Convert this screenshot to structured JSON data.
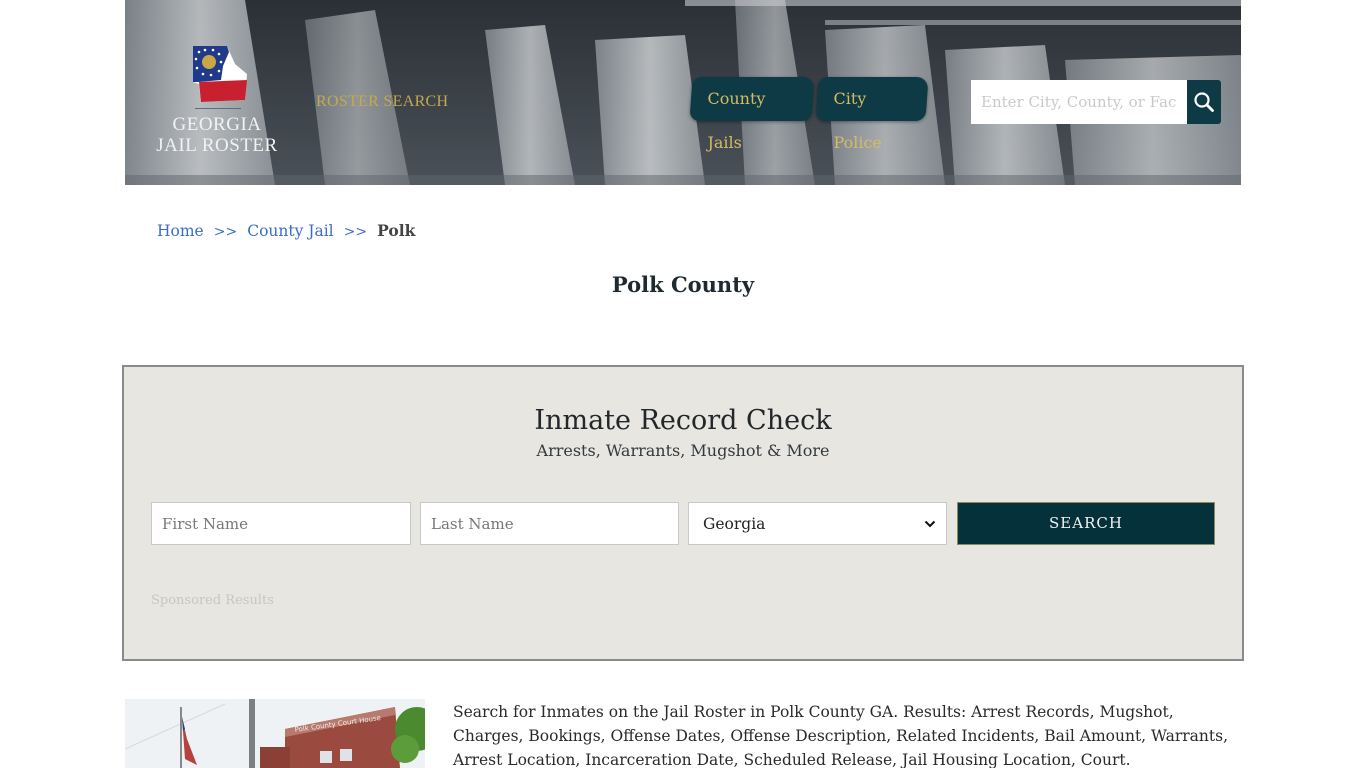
{
  "header": {
    "logo": {
      "line1": "GEORGIA",
      "line2": "JAIL ROSTER",
      "icon": "georgia-flag-map-icon"
    },
    "roster_search_label": "ROSTER SEARCH",
    "nav": [
      {
        "label": "County Jails"
      },
      {
        "label": "City Police"
      }
    ],
    "search": {
      "placeholder": "Enter City, County, or Facility",
      "value": "",
      "icon": "search-icon"
    },
    "colors": {
      "nav_bg": "#0d3a44",
      "nav_text": "#d5bb62",
      "roster_text": "#c5a94d"
    }
  },
  "breadcrumb": {
    "items": [
      {
        "label": "Home"
      },
      {
        "label": "County Jail"
      },
      {
        "label": "Polk"
      }
    ],
    "separator": ">>"
  },
  "page_title": "Polk County",
  "record_check": {
    "title": "Inmate Record Check",
    "subtitle": "Arrests, Warrants, Mugshot & More",
    "first_name": {
      "placeholder": "First Name",
      "value": ""
    },
    "last_name": {
      "placeholder": "Last Name",
      "value": ""
    },
    "state": {
      "selected": "Georgia"
    },
    "submit_label": "SEARCH",
    "sponsored_label": "Sponsored Results",
    "colors": {
      "box_bg": "#e8e6e1",
      "button_bg": "#05313b"
    }
  },
  "content": {
    "image_caption": "Polk County Court House",
    "description": "Search for Inmates on the Jail Roster in Polk County GA. Results: Arrest Records, Mugshot, Charges, Bookings, Offense Dates, Offense Description, Related Incidents, Bail Amount, Warrants, Arrest Location, Incarceration Date, Scheduled Release, Jail Housing Location, Court."
  }
}
